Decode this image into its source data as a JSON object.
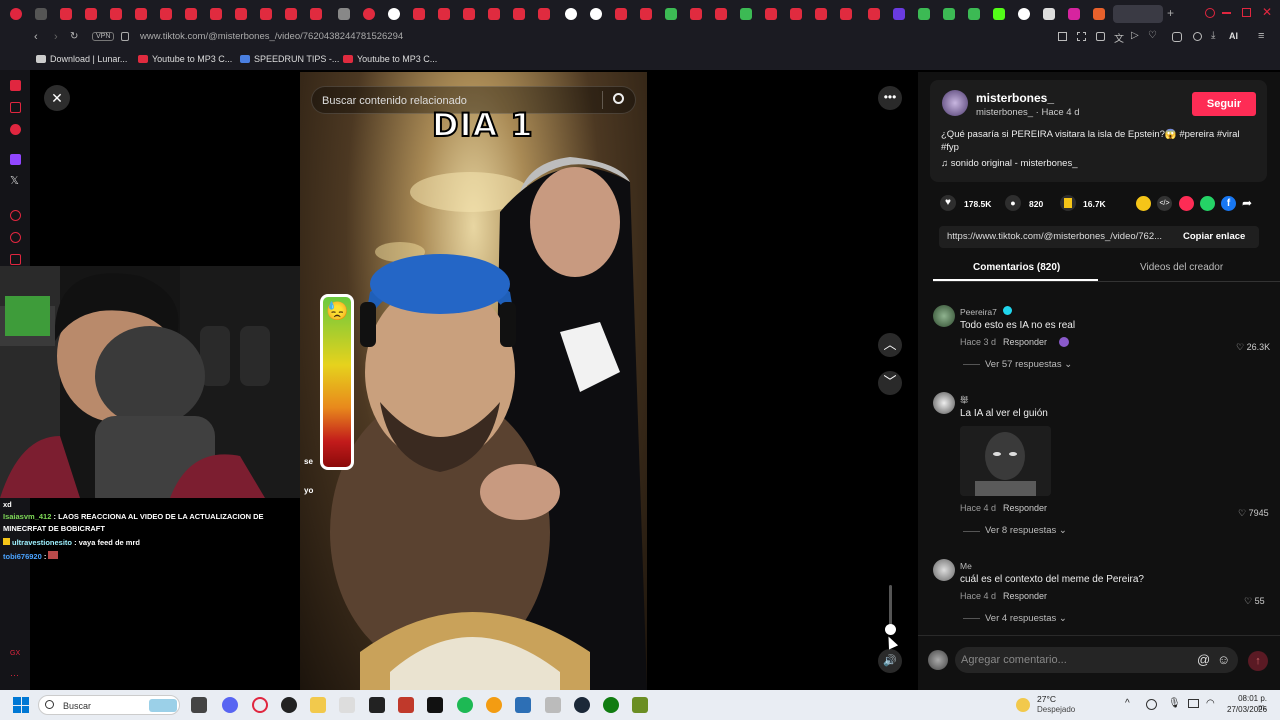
{
  "browser": {
    "url": "www.tiktok.com/@misterbones_/video/7620438244781526294",
    "vpn_label": "VPN",
    "ai_label": "AI",
    "bookmarks": [
      {
        "label": "Download | Lunar..."
      },
      {
        "label": "Youtube to MP3 C..."
      },
      {
        "label": "SPEEDRUN TIPS -..."
      },
      {
        "label": "Youtube to MP3 C..."
      }
    ]
  },
  "video": {
    "search_placeholder": "Buscar contenido relacionado",
    "caption_overlay": "DIA 1",
    "meter_emoji": "😓",
    "side_letter_top": "se",
    "side_letter_bottom": "yo"
  },
  "stream_chat": {
    "lines": [
      {
        "user": "xd",
        "text": "",
        "color": "#ffffff"
      },
      {
        "user": "Isaiasvm_412",
        "text": ": LAOS REACCIONA AL VIDEO DE LA ACTUALIZACION DE MINECRFAT DE BOBICRAFT",
        "color": "#7ed957"
      },
      {
        "user": "ultravestionesito",
        "text": ": vaya feed de mrd",
        "color": "#9ef1ff"
      },
      {
        "user": "tobi676920",
        "text": ":",
        "color": "#4aa3ff"
      }
    ]
  },
  "creator": {
    "name": "misterbones_",
    "handle_time": "misterbones_ · Hace 4 d",
    "follow_label": "Seguir",
    "description": "¿Qué pasaría si PEREIRA visitara la isla de Epstein?😱 #pereira #viral #fyp",
    "sound": "sonido original - misterbones_"
  },
  "stats": {
    "likes": "178.5K",
    "comments": "820",
    "saves": "16.7K"
  },
  "link": {
    "url": "https://www.tiktok.com/@misterbones_/video/762...",
    "copy_label": "Copiar enlace"
  },
  "tabs": {
    "comments": "Comentarios (820)",
    "creator_videos": "Videos del creador"
  },
  "comments": [
    {
      "user": "Peereira7",
      "text": "Todo esto es IA no es real",
      "time": "Hace 3 d",
      "reply": "Responder",
      "likes": "26.3K",
      "replies": "Ver 57 respuestas"
    },
    {
      "user": "舉",
      "text": "La IA al ver el guión",
      "time": "Hace 4 d",
      "reply": "Responder",
      "likes": "7945",
      "replies": "Ver 8 respuestas"
    },
    {
      "user": "Me",
      "text": "cuál es el contexto del meme de Pereira?",
      "time": "Hace 4 d",
      "reply": "Responder",
      "likes": "55",
      "replies": "Ver 4 respuestas"
    }
  ],
  "comment_input": {
    "placeholder": "Agregar comentario..."
  },
  "taskbar": {
    "search": "Buscar",
    "temp": "27°C",
    "weather": "Despejado",
    "time": "08:01 p. m.",
    "date": "27/03/2026"
  },
  "colors": {
    "follow": "#fe2c55",
    "save_icon": "#f5c518",
    "accent_tab_underline": "#ffffff"
  }
}
